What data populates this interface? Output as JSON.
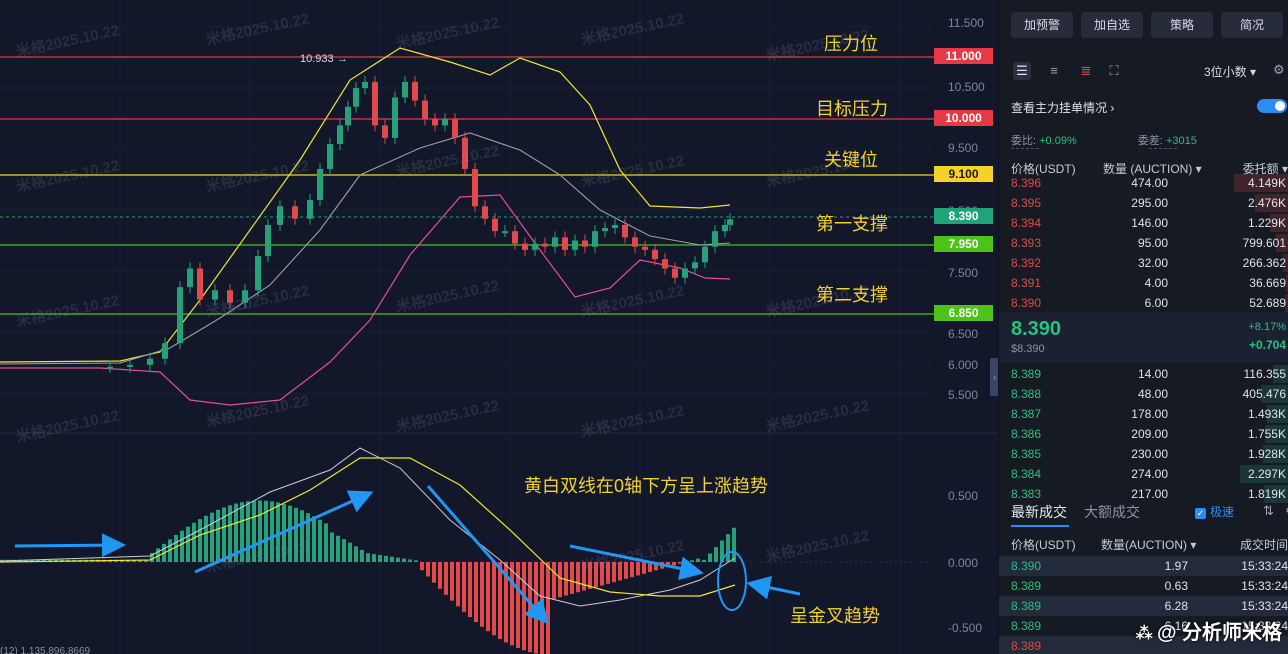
{
  "watermark": "米格2025.10.22",
  "chart": {
    "high_label": "10.933",
    "price_axis": [
      "11.500",
      "10.500",
      "9.500",
      "8.500",
      "7.500",
      "6.500",
      "6.000",
      "5.500"
    ],
    "macd_axis": [
      "0.500",
      "0.000",
      "-0.500"
    ],
    "price_tags": [
      {
        "value": "11.000",
        "color": "#e53945"
      },
      {
        "value": "10.000",
        "color": "#e53945"
      },
      {
        "value": "9.100",
        "color": "#f3d22b"
      },
      {
        "value": "8.390",
        "color": "#1fa47a"
      },
      {
        "value": "7.950",
        "color": "#4cc21a"
      },
      {
        "value": "6.850",
        "color": "#4cc21a"
      }
    ],
    "annotations": {
      "resistance": "压力位",
      "target_resistance": "目标压力",
      "key_level": "关键位",
      "support1": "第一支撑",
      "support2": "第二支撑",
      "macd_note": "黄白双线在0轴下方呈上涨趋势",
      "golden_cross": "呈金叉趋势"
    },
    "bottom_label": "(12) 1,135,896.8669",
    "colors": {
      "up": "#26a17a",
      "down": "#e04a4a",
      "resistance": "#e53945",
      "key": "#f3d22b",
      "support": "#4cc21a",
      "arrow": "#2196f3"
    }
  },
  "panel": {
    "buttons": [
      "加预警",
      "加自选",
      "策略",
      "简况"
    ],
    "decimal": "3位小数",
    "main_view": "查看主力挂单情况",
    "ratio_label": "委比:",
    "ratio_value": "+0.09%",
    "diff_label": "委差:",
    "diff_value": "+3015",
    "ob_headers": {
      "price": "价格(USDT)",
      "qty": "数量 (AUCTION)",
      "total": "委托额"
    },
    "asks": [
      {
        "price": "8.396",
        "qty": "474.00",
        "total": "4.149K"
      },
      {
        "price": "8.395",
        "qty": "295.00",
        "total": "2.476K"
      },
      {
        "price": "8.394",
        "qty": "146.00",
        "total": "1.229K"
      },
      {
        "price": "8.393",
        "qty": "95.00",
        "total": "799.601"
      },
      {
        "price": "8.392",
        "qty": "32.00",
        "total": "266.362"
      },
      {
        "price": "8.391",
        "qty": "4.00",
        "total": "36.669"
      },
      {
        "price": "8.390",
        "qty": "6.00",
        "total": "52.689"
      }
    ],
    "last_price": "8.390",
    "last_price_usd": "$8.390",
    "change_pct": "+8.17%",
    "change_abs": "+0.704",
    "bids": [
      {
        "price": "8.389",
        "qty": "14.00",
        "total": "116.355"
      },
      {
        "price": "8.388",
        "qty": "48.00",
        "total": "405.476"
      },
      {
        "price": "8.387",
        "qty": "178.00",
        "total": "1.493K"
      },
      {
        "price": "8.386",
        "qty": "209.00",
        "total": "1.755K"
      },
      {
        "price": "8.385",
        "qty": "230.00",
        "total": "1.928K"
      },
      {
        "price": "8.384",
        "qty": "274.00",
        "total": "2.297K"
      },
      {
        "price": "8.383",
        "qty": "217.00",
        "total": "1.819K"
      }
    ],
    "tab_latest": "最新成交",
    "tab_large": "大额成交",
    "fast": "极速",
    "trade_headers": {
      "price": "价格(USDT)",
      "qty": "数量(AUCTION)",
      "time": "成交时间"
    },
    "trades": [
      {
        "price": "8.390",
        "qty": "1.97",
        "time": "15:33:24"
      },
      {
        "price": "8.389",
        "qty": "0.63",
        "time": "15:33:24"
      },
      {
        "price": "8.389",
        "qty": "6.28",
        "time": "15:33:24"
      },
      {
        "price": "8.389",
        "qty": "6.16",
        "time": "15:33:24"
      },
      {
        "price": "8.389",
        "qty": "",
        "time": ""
      }
    ],
    "brand": "@ 分析师米格"
  }
}
